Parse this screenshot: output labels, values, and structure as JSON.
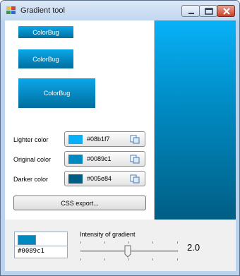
{
  "window": {
    "title": "Gradient tool"
  },
  "preview_buttons": [
    {
      "label": "ColorBug"
    },
    {
      "label": "ColorBug"
    },
    {
      "label": "ColorBug"
    }
  ],
  "colors": [
    {
      "label": "Lighter color",
      "hex": "#08b1f7"
    },
    {
      "label": "Original color",
      "hex": "#0089c1"
    },
    {
      "label": "Darker color",
      "hex": "#005e84"
    }
  ],
  "css_export_label": "CSS export...",
  "picker": {
    "value": "#0089c1"
  },
  "intensity": {
    "label": "Intensity of gradient",
    "value_text": "2.0",
    "slider_fraction": 0.45
  },
  "icons": {
    "app": "palette-icon",
    "copy": "copy-icon",
    "minimize": "minimize-icon",
    "maximize": "maximize-icon",
    "close": "close-icon",
    "thumb": "slider-thumb-icon"
  }
}
